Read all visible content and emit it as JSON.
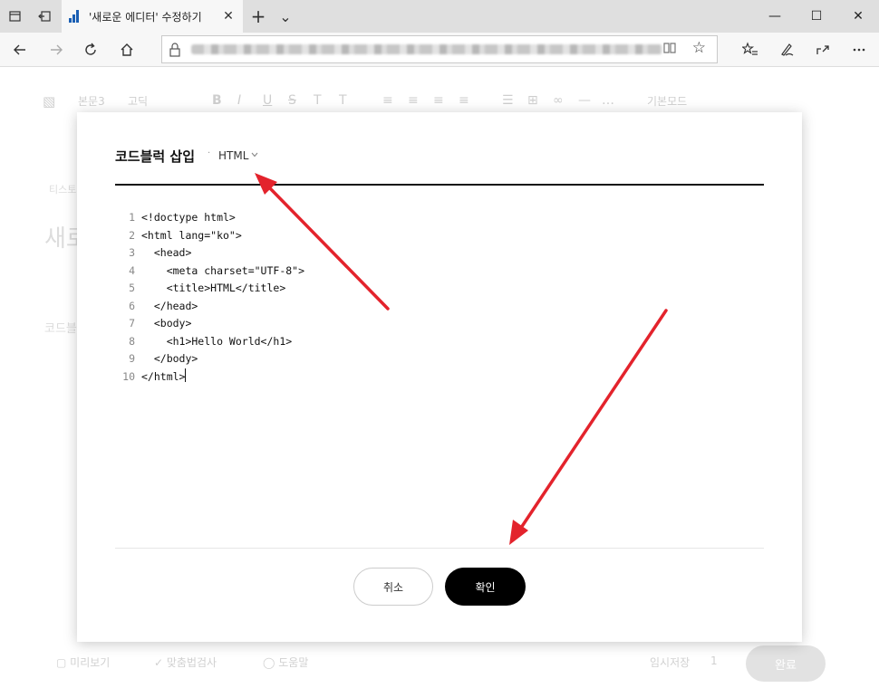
{
  "browser": {
    "tab_title": "'새로운 에디터' 수정하기",
    "tab_close": "✕",
    "new_tab": "+",
    "tab_menu": "⌄",
    "win_min": "—",
    "win_max": "☐",
    "win_close": "✕"
  },
  "editor_bg": {
    "toolbar": [
      "본문3",
      "고딕",
      "기본모드"
    ],
    "ghost_text": [
      "티스토",
      "새로",
      "코드블"
    ],
    "footer": {
      "preview": "미리보기",
      "spell": "맞춤법검사",
      "help": "도움말",
      "temp_save": "임시저장",
      "temp_count": "1",
      "done": "완료"
    }
  },
  "dialog": {
    "title": "코드블럭 삽입",
    "separator": "·",
    "language": "HTML",
    "code_lines": [
      {
        "n": "1",
        "text": "<!doctype html>"
      },
      {
        "n": "2",
        "text": "<html lang=\"ko\">"
      },
      {
        "n": "3",
        "text": "  <head>"
      },
      {
        "n": "4",
        "text": "    <meta charset=\"UTF-8\">"
      },
      {
        "n": "5",
        "text": "    <title>HTML</title>"
      },
      {
        "n": "6",
        "text": "  </head>"
      },
      {
        "n": "7",
        "text": "  <body>"
      },
      {
        "n": "8",
        "text": "    <h1>Hello World</h1>"
      },
      {
        "n": "9",
        "text": "  </body>"
      },
      {
        "n": "10",
        "text": "</html>"
      }
    ],
    "cancel_label": "취소",
    "confirm_label": "확인"
  },
  "colors": {
    "arrow": "#e3232c",
    "confirm_bg": "#000000",
    "rule": "#111111"
  }
}
